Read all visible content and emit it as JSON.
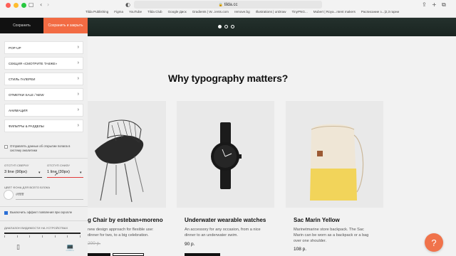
{
  "browser": {
    "url": "tilda.cc",
    "bookmarks": [
      "Tilda Publishing",
      "Figma",
      "YouTube",
      "Tilda Club",
      "Google Диск",
      "Gradients | W...ients.com",
      "remove.bg",
      "Illustrations | unDraw",
      "TinyPNG...",
      "Mubert | Roya...ntent makers",
      "Расписание з...|2,3 гарни"
    ]
  },
  "panel": {
    "save_label": "Сохранить",
    "save_close_label": "Сохранить и закрыть",
    "sections": [
      "POP-UP",
      "СЕКЦИЯ «СМОТРИТЕ ТАКЖЕ»",
      "СТИЛЬ ГАЛЕРЕИ",
      "ОТМЕТКИ SALE / NEW",
      "АНИМАЦИЯ",
      "ФИЛЬТРЫ & РАЗДЕЛЫ"
    ],
    "analytics_checkbox": "Отправлять данные об открытии попапа в систему аналитики",
    "padding_top_label": "ОТСТУП СВЕРХУ",
    "padding_top_value": "3 line (90px)",
    "padding_bottom_label": "ОТСТУП СНИЗУ",
    "padding_bottom_value": "1 line (30px)",
    "bg_color_label": "ЦВЕТ ФОНА ДЛЯ ВСЕГО БЛОКА",
    "bg_color_value": "#ffffff",
    "scroll_effect_label": "Выключить эффект появления при скролле",
    "visibility_range_label": "ДИАПАЗОН ВИДИМОСТИ НА УСТРОЙСТВАХ"
  },
  "page": {
    "title": "Why typography matters?",
    "products": [
      {
        "title": "g Chair by esteban+moreno",
        "desc": "new design approach for flexible use: dinner for two, to a big celebration.",
        "price": "200 р."
      },
      {
        "title": "Underwater wearable watches",
        "desc": "An accessory for any occasion, from a nice dinner to an underwater swim.",
        "price": "90 р."
      },
      {
        "title": "Sac Marin Yellow",
        "desc": "Marinetmarine store backpack. The Sac Marin can be worn as a backpack or a bag over one shoulder.",
        "price": "108 р."
      }
    ],
    "help_icon": "?"
  },
  "colors": {
    "accent": "#f26b43",
    "dark": "#111111",
    "panel_bg": "#efefef"
  }
}
